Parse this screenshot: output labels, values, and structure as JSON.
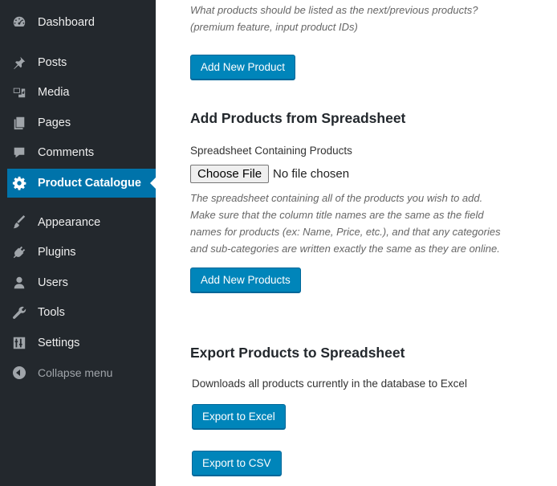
{
  "sidebar": {
    "items": [
      {
        "label": "Dashboard",
        "icon": "dashboard-icon"
      },
      {
        "label": "Posts",
        "icon": "pin-icon"
      },
      {
        "label": "Media",
        "icon": "media-icon"
      },
      {
        "label": "Pages",
        "icon": "pages-icon"
      },
      {
        "label": "Comments",
        "icon": "comment-icon"
      },
      {
        "label": "Product Catalogue",
        "icon": "gear-icon",
        "active": true
      },
      {
        "label": "Appearance",
        "icon": "brush-icon"
      },
      {
        "label": "Plugins",
        "icon": "plug-icon"
      },
      {
        "label": "Users",
        "icon": "user-icon"
      },
      {
        "label": "Tools",
        "icon": "wrench-icon"
      },
      {
        "label": "Settings",
        "icon": "sliders-icon"
      }
    ],
    "collapse_label": "Collapse menu",
    "colors": {
      "background": "#23282d",
      "active": "#0073aa"
    }
  },
  "main": {
    "next_prev": {
      "description_line1": "What products should be listed as the next/previous products?",
      "description_line2": "(premium feature, input product IDs)",
      "button_label": "Add New Product"
    },
    "import": {
      "heading": "Add Products from Spreadsheet",
      "field_label": "Spreadsheet Containing Products",
      "file_button_label": "Choose File",
      "file_status": "No file chosen",
      "help_lines": [
        "The spreadsheet containing all of the products you wish to add.",
        "Make sure that the column title names are the same as the field",
        "names for products (ex: Name, Price, etc.), and that any categories",
        "and sub-categories are written exactly the same as they are online."
      ],
      "button_label": "Add New Products"
    },
    "export": {
      "heading": "Export Products to Spreadsheet",
      "description": "Downloads all products currently in the database to Excel",
      "excel_button_label": "Export to Excel",
      "csv_button_label": "Export to CSV"
    },
    "colors": {
      "primary_button": "#0085ba"
    }
  }
}
